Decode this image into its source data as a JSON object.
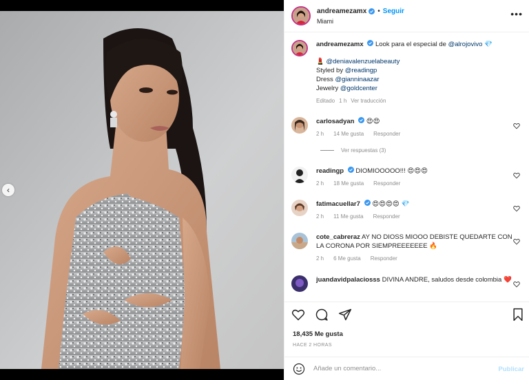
{
  "post": {
    "author": "andreamezamx",
    "follow_label": "Seguir",
    "location": "Miami",
    "dot": "•",
    "more_label": "•••"
  },
  "caption": {
    "username": "andreamezamx",
    "text_before": "Look para el especial de ",
    "mention": "@alrojovivo",
    "emoji_gem": "💎",
    "line1_emoji": "💄",
    "line1_mention": "@deniavalenzuelabeauty",
    "line2_prefix": "Styled by ",
    "line2_mention": "@readingp",
    "line3_prefix": "Dress ",
    "line3_mention": "@gianninaazar",
    "line4_prefix": "Jewelry ",
    "line4_mention": "@goldcenter",
    "edited": "Editado",
    "time": "1 h",
    "translate": "Ver traducción"
  },
  "comments": [
    {
      "username": "carlosadyan",
      "text": "😍😍",
      "time": "2 h",
      "likes": "14 Me gusta",
      "reply": "Responder"
    },
    {
      "username": "readingp",
      "text": "DIOMIOOOOO!!! 😍😍😍",
      "time": "2 h",
      "likes": "18 Me gusta",
      "reply": "Responder"
    },
    {
      "username": "fatimacuellar7",
      "text": "😍😍😍😍 💎",
      "time": "2 h",
      "likes": "11 Me gusta",
      "reply": "Responder"
    },
    {
      "username": "cote_cabreraz",
      "text": "AY NO DIOSS MIOOO DEBISTE QUEDARTE CON LA CORONA POR SIEMPREEEEEEE 🔥",
      "time": "2 h",
      "likes": "6 Me gusta",
      "reply": "Responder"
    },
    {
      "username": "juandavidpalaciosss",
      "text": "DIVINA ANDRE, saludos desde colombia ❤️",
      "time": "",
      "likes": "",
      "reply": ""
    }
  ],
  "view_replies": "Ver respuestas (3)",
  "likes_count": "18,435 Me gusta",
  "posted_time": "HACE 2 HORAS",
  "composer": {
    "placeholder": "Añade un comentario...",
    "publish": "Publicar"
  },
  "nav_arrow": "‹",
  "colors": {
    "link": "#00376b",
    "accent": "#0095f6",
    "publish_disabled": "#b2dffc",
    "muted": "#8e8e8e",
    "verified": "#3897f0"
  },
  "icons": [
    "heart-icon",
    "comment-icon",
    "share-icon",
    "bookmark-icon",
    "emoji-icon",
    "verified-icon",
    "more-icon"
  ]
}
